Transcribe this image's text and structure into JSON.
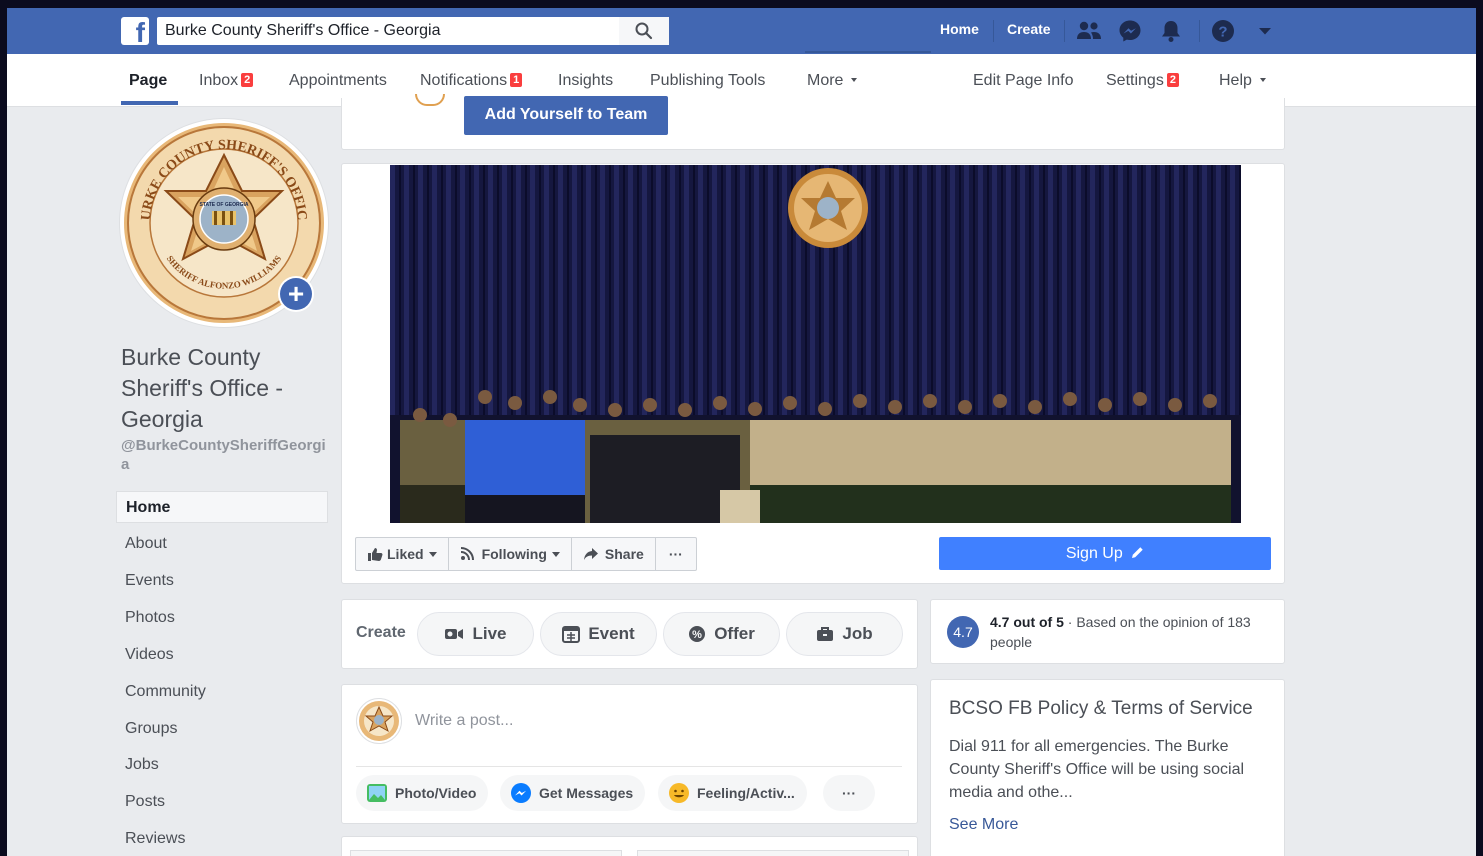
{
  "topbar": {
    "search_value": "Burke County Sheriff's Office - Georgia",
    "home": "Home",
    "create": "Create",
    "icons": [
      "friends-icon",
      "messenger-icon",
      "notifications-bell-icon",
      "help-icon",
      "account-menu-caret-icon"
    ]
  },
  "tabs": {
    "page": "Page",
    "inbox": "Inbox",
    "inbox_badge": "2",
    "appointments": "Appointments",
    "notifications": "Notifications",
    "notifications_badge": "1",
    "insights": "Insights",
    "publishing_tools": "Publishing Tools",
    "more": "More",
    "edit_page_info": "Edit Page Info",
    "settings": "Settings",
    "settings_badge": "2",
    "help": "Help"
  },
  "profile": {
    "name": "Burke County Sheriff's Office - Georgia",
    "handle": "@BurkeCountySheriffGeorgia",
    "seal_text_top": "BURKE COUNTY SHERIFF'S OFFICE",
    "seal_text_bottom": "SHERIFF ALFONZO WILLIAMS",
    "seal_inner": "STATE OF GEORGIA"
  },
  "left_nav": [
    "Home",
    "About",
    "Events",
    "Photos",
    "Videos",
    "Community",
    "Groups",
    "Jobs",
    "Posts",
    "Reviews"
  ],
  "team": {
    "button": "Add Yourself to Team"
  },
  "actions": {
    "liked": "Liked",
    "following": "Following",
    "share": "Share",
    "more": "···",
    "signup": "Sign Up"
  },
  "create": {
    "label": "Create",
    "live": "Live",
    "event": "Event",
    "offer": "Offer",
    "job": "Job"
  },
  "rating": {
    "score": "4.7",
    "summary": "4.7 out of 5",
    "detail": "· Based on the opinion of 183 people"
  },
  "composer": {
    "placeholder": "Write a post...",
    "photo_video": "Photo/Video",
    "get_messages": "Get Messages",
    "feeling": "Feeling/Activ...",
    "more": "···"
  },
  "policy": {
    "title": "BCSO FB Policy & Terms of Service",
    "body": "Dial 911 for all emergencies. The Burke County Sheriff's Office will be using social media and othe...",
    "see_more": "See More"
  },
  "colors": {
    "brand_blue": "#4267b2",
    "signup_blue": "#4080ff",
    "badge_red": "#fa3e3e",
    "seal_gold": "#d9a35f"
  }
}
